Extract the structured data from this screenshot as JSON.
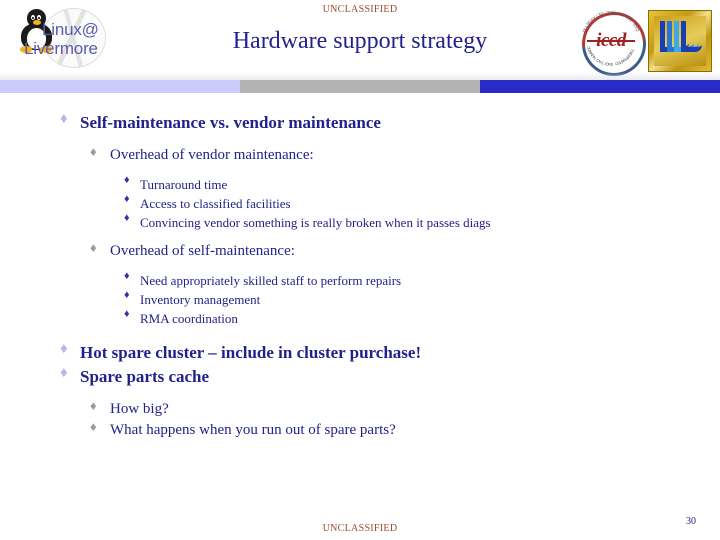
{
  "slide": {
    "classification_top": "UNCLASSIFIED",
    "classification_bottom": "UNCLASSIFIED",
    "title": "Hardware support strategy",
    "page_number": "30"
  },
  "logos": {
    "linux_line1": "Linux@",
    "linux_line2": "Livermore",
    "iccd_word": "iccd",
    "iccd_ring_top": "INTEGRATED COMPUTING AND",
    "iccd_ring_bottom": "COMMUNICATIONS DEPARTMENT",
    "llnl_alt": "LLNL logo"
  },
  "colors": {
    "title_navy": "#22228C",
    "classification_red": "#9C4A2A",
    "bar_lavender": "#ccccfa",
    "bar_gray": "#b3b3b3",
    "bar_blue": "#2a2ac8",
    "bullet_l1": "#b6b6ea",
    "bullet_l2": "#9a9a9a",
    "bullet_l3": "#3333a0"
  },
  "bullet_glyph": "♦",
  "content": {
    "items": [
      {
        "level": 1,
        "text": "Self-maintenance vs. vendor maintenance"
      },
      {
        "level": 2,
        "text": "Overhead of vendor maintenance:"
      },
      {
        "level": 3,
        "text": "Turnaround time"
      },
      {
        "level": 3,
        "text": "Access to classified facilities"
      },
      {
        "level": 3,
        "text": "Convincing vendor something is really broken when it passes diags"
      },
      {
        "level": 2,
        "text": "Overhead of self-maintenance:"
      },
      {
        "level": 3,
        "text": "Need appropriately skilled staff to perform repairs"
      },
      {
        "level": 3,
        "text": "Inventory management"
      },
      {
        "level": 3,
        "text": "RMA coordination"
      },
      {
        "level": 1,
        "text": "Hot spare cluster – include in cluster purchase!"
      },
      {
        "level": 1,
        "text": "Spare parts cache"
      },
      {
        "level": 2,
        "text": "How big?"
      },
      {
        "level": 2,
        "text": "What happens when you run out of spare parts?"
      }
    ]
  }
}
